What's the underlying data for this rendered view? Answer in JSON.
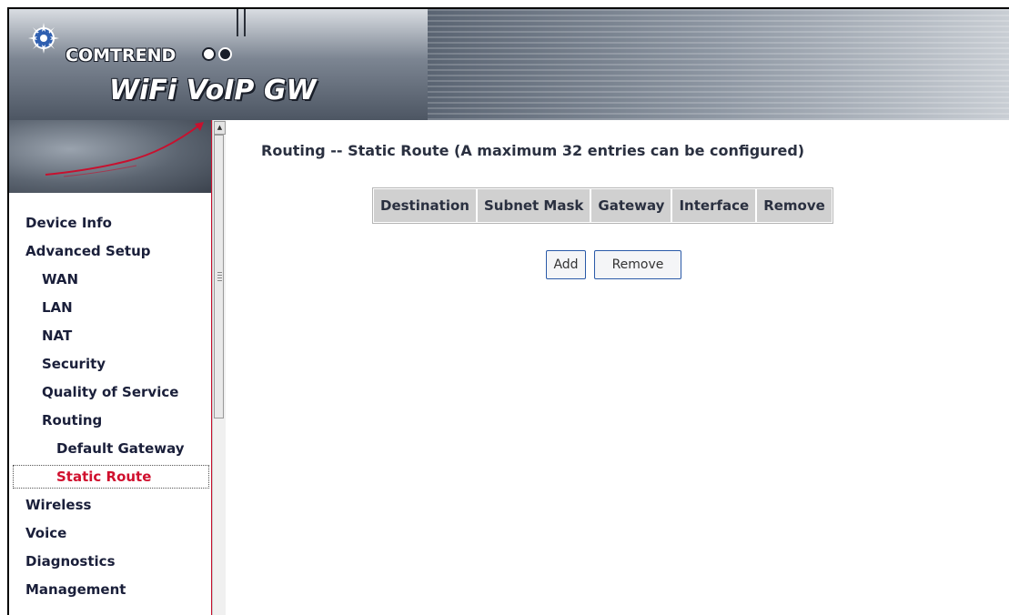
{
  "banner": {
    "brand": "COMTREND",
    "product": "WiFi VoIP GW"
  },
  "sidebar": {
    "items": [
      {
        "label": "Device Info",
        "level": 1
      },
      {
        "label": "Advanced Setup",
        "level": 1
      },
      {
        "label": "WAN",
        "level": 2
      },
      {
        "label": "LAN",
        "level": 2
      },
      {
        "label": "NAT",
        "level": 2
      },
      {
        "label": "Security",
        "level": 2
      },
      {
        "label": "Quality of Service",
        "level": 2
      },
      {
        "label": "Routing",
        "level": 2
      },
      {
        "label": "Default Gateway",
        "level": 3
      },
      {
        "label": "Static Route",
        "level": 3,
        "active": true
      },
      {
        "label": "Wireless",
        "level": 1
      },
      {
        "label": "Voice",
        "level": 1
      },
      {
        "label": "Diagnostics",
        "level": 1
      },
      {
        "label": "Management",
        "level": 1
      }
    ]
  },
  "main": {
    "title": "Routing -- Static Route (A maximum 32 entries can be configured)",
    "table": {
      "columns": [
        "Destination",
        "Subnet Mask",
        "Gateway",
        "Interface",
        "Remove"
      ],
      "rows": []
    },
    "buttons": {
      "add": "Add",
      "remove": "Remove"
    }
  },
  "colors": {
    "active_nav": "#d0102e",
    "nav_text": "#1a1f3a",
    "table_header_bg": "#d0d0d0",
    "sidebar_divider": "#c8102e"
  }
}
